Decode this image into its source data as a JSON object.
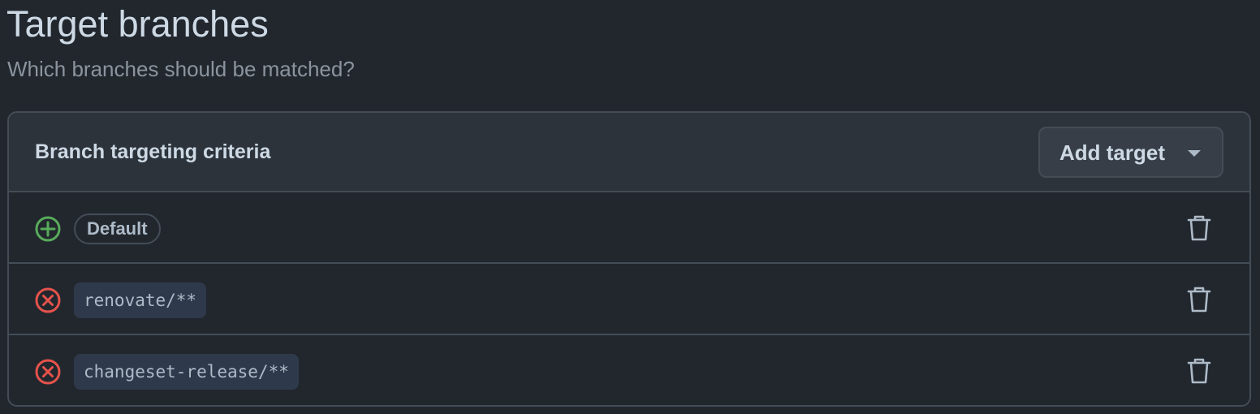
{
  "header": {
    "title": "Target branches",
    "subtitle": "Which branches should be matched?"
  },
  "criteria": {
    "title": "Branch targeting criteria",
    "add_button_label": "Add target",
    "rows": [
      {
        "label": "Default",
        "kind": "include",
        "icon": "plus-circle-icon",
        "style": "pill"
      },
      {
        "label": "renovate/**",
        "kind": "exclude",
        "icon": "x-circle-icon",
        "style": "code"
      },
      {
        "label": "changeset-release/**",
        "kind": "exclude",
        "icon": "x-circle-icon",
        "style": "code"
      }
    ]
  },
  "colors": {
    "background": "#22272e",
    "header_background": "#2d333b",
    "border": "#444c56",
    "include": "#57ab5a",
    "exclude": "#e5534b"
  }
}
